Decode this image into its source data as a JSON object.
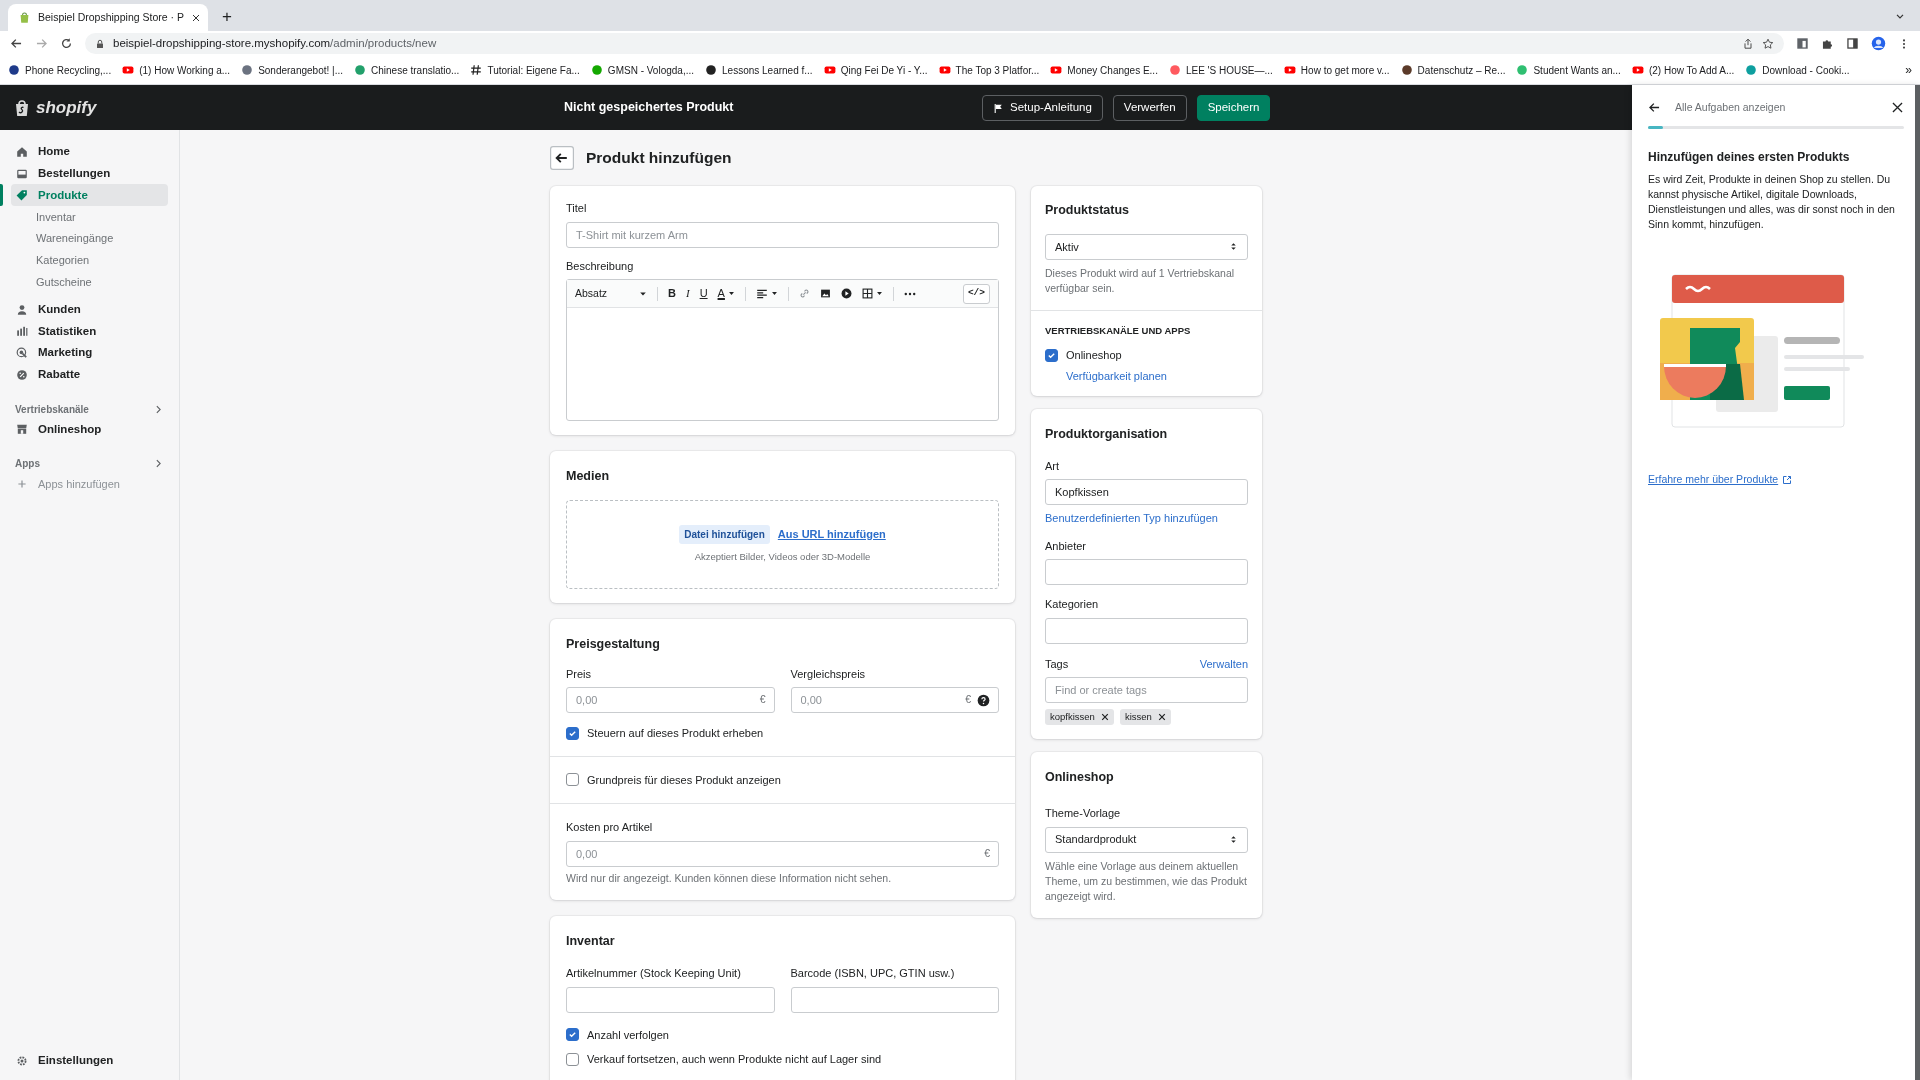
{
  "browser": {
    "tab": {
      "title": "Beispiel Dropshipping Store · P",
      "selected": true
    },
    "new_tab": "+",
    "url_host": "beispiel-dropshipping-store.myshopify.com",
    "url_path": "/admin/products/new",
    "bookmarks": [
      {
        "label": "Phone Recycling,...",
        "kind": "dot",
        "color": "#1e3a8a"
      },
      {
        "label": "(1) How Working a...",
        "kind": "youtube"
      },
      {
        "label": "Sonderangebot! |...",
        "kind": "dot",
        "color": "#6b7280"
      },
      {
        "label": "Chinese translatio...",
        "kind": "dot",
        "color": "#22a06b"
      },
      {
        "label": "Tutorial: Eigene Fa...",
        "kind": "hash"
      },
      {
        "label": "GMSN - Vologda,...",
        "kind": "dot",
        "color": "#14a800"
      },
      {
        "label": "Lessons Learned f...",
        "kind": "dot",
        "color": "#222222"
      },
      {
        "label": "Qing Fei De Yi - Y...",
        "kind": "youtube"
      },
      {
        "label": "The Top 3 Platfor...",
        "kind": "youtube"
      },
      {
        "label": "Money Changes E...",
        "kind": "youtube"
      },
      {
        "label": "LEE 'S HOUSE—...",
        "kind": "dot",
        "color": "#ff5a5f"
      },
      {
        "label": "How to get more v...",
        "kind": "youtube"
      },
      {
        "label": "Datenschutz – Re...",
        "kind": "dot",
        "color": "#5b3a29"
      },
      {
        "label": "Student Wants an...",
        "kind": "dot",
        "color": "#2fbf71"
      },
      {
        "label": "(2) How To Add A...",
        "kind": "youtube"
      },
      {
        "label": "Download - Cooki...",
        "kind": "dot",
        "color": "#0e9f9f"
      }
    ],
    "more": "»"
  },
  "topbar": {
    "logo": "shopify",
    "title": "Nicht gespeichertes Produkt",
    "buttons": [
      {
        "label": "Setup-Anleitung",
        "kind": "setup"
      },
      {
        "label": "Verwerfen",
        "kind": "secondary"
      },
      {
        "label": "Speichern",
        "kind": "primary"
      }
    ]
  },
  "sidebar": {
    "items": [
      {
        "label": "Home",
        "selected": false
      },
      {
        "label": "Bestellungen",
        "selected": false
      },
      {
        "label": "Produkte",
        "selected": true,
        "children": [
          {
            "label": "Inventar"
          },
          {
            "label": "Wareneingänge"
          },
          {
            "label": "Kategorien"
          },
          {
            "label": "Gutscheine"
          }
        ]
      },
      {
        "label": "Kunden",
        "selected": false
      },
      {
        "label": "Statistiken",
        "selected": false
      },
      {
        "label": "Marketing",
        "selected": false
      },
      {
        "label": "Rabatte",
        "selected": false
      }
    ],
    "sections": [
      {
        "title": "Vertriebskanäle",
        "items": [
          {
            "label": "Onlineshop",
            "kind": "main"
          }
        ]
      },
      {
        "title": "Apps",
        "items": [
          {
            "label": "Apps hinzufügen",
            "kind": "muted"
          }
        ]
      }
    ],
    "settings": "Einstellungen"
  },
  "page": {
    "title": "Produkt hinzufügen",
    "details": {
      "title_field": {
        "label": "Titel",
        "placeholder": "T-Shirt mit kurzem Arm"
      },
      "description": {
        "label": "Beschreibung",
        "format": "Absatz",
        "format_buttons": [
          {
            "label": "B",
            "kind": "bold"
          },
          {
            "label": "I",
            "kind": "italic"
          },
          {
            "label": "U",
            "kind": "underline"
          },
          {
            "label": "A",
            "kind": "color"
          }
        ],
        "code_button": "</>"
      }
    },
    "media": {
      "title": "Medien",
      "upload_button": "Datei hinzufügen",
      "url_link": "Aus URL hinzufügen",
      "hint": "Akzeptiert Bilder, Videos oder 3D-Modelle"
    },
    "pricing": {
      "title": "Preisgestaltung",
      "fields": [
        {
          "label": "Preis",
          "placeholder": "0,00",
          "suffix": "€"
        },
        {
          "label": "Vergleichspreis",
          "placeholder": "0,00",
          "suffix": "€",
          "help": true
        }
      ],
      "tax": {
        "label": "Steuern auf dieses Produkt erheben",
        "checked": true
      },
      "unit_price": {
        "label": "Grundpreis für dieses Produkt anzeigen",
        "checked": false
      },
      "cost": {
        "label": "Kosten pro Artikel",
        "placeholder": "0,00",
        "suffix": "€",
        "hint": "Wird nur dir angezeigt. Kunden können diese Information nicht sehen."
      }
    },
    "inventory": {
      "title": "Inventar",
      "fields": [
        {
          "label": "Artikelnummer (Stock Keeping Unit)"
        },
        {
          "label": "Barcode (ISBN, UPC, GTIN usw.)"
        }
      ],
      "options": [
        {
          "label": "Anzahl verfolgen",
          "checked": true
        },
        {
          "label": "Verkauf fortsetzen, auch wenn Produkte nicht auf Lager sind",
          "checked": false
        }
      ]
    },
    "status": {
      "title": "Produktstatus",
      "value": "Aktiv",
      "hint": "Dieses Produkt wird auf 1 Vertriebskanal verfügbar sein.",
      "channels_heading": "VERTRIEBSKANÄLE UND APPS",
      "channels": [
        {
          "label": "Onlineshop",
          "checked": true,
          "link": "Verfügbarkeit planen"
        }
      ]
    },
    "organization": {
      "title": "Produktorganisation",
      "type": {
        "label": "Art",
        "value": "Kopfkissen",
        "link": "Benutzerdefinierten Typ hinzufügen"
      },
      "vendor": {
        "label": "Anbieter"
      },
      "category": {
        "label": "Kategorien"
      },
      "tags": {
        "label": "Tags",
        "manage": "Verwalten",
        "placeholder": "Find or create tags",
        "items": [
          "kopfkissen",
          "kissen"
        ]
      }
    },
    "online_store": {
      "title": "Onlineshop",
      "label": "Theme-Vorlage",
      "value": "Standardprodukt",
      "hint": "Wähle eine Vorlage aus deinem aktuellen Theme, um zu bestimmen, wie das Produkt angezeigt wird."
    }
  },
  "guide": {
    "back": "Alle Aufgaben anzeigen",
    "progress": {
      "level": 0.06
    },
    "heading": "Hinzufügen deines ersten Produkts",
    "text": "Es wird Zeit, Produkte in deinen Shop zu stellen. Du kannst physische Artikel, digitale Downloads, Dienstleistungen und alles, was dir sonst noch in den Sinn kommt, hinzufügen.",
    "link": "Erfahre mehr über Produkte"
  }
}
